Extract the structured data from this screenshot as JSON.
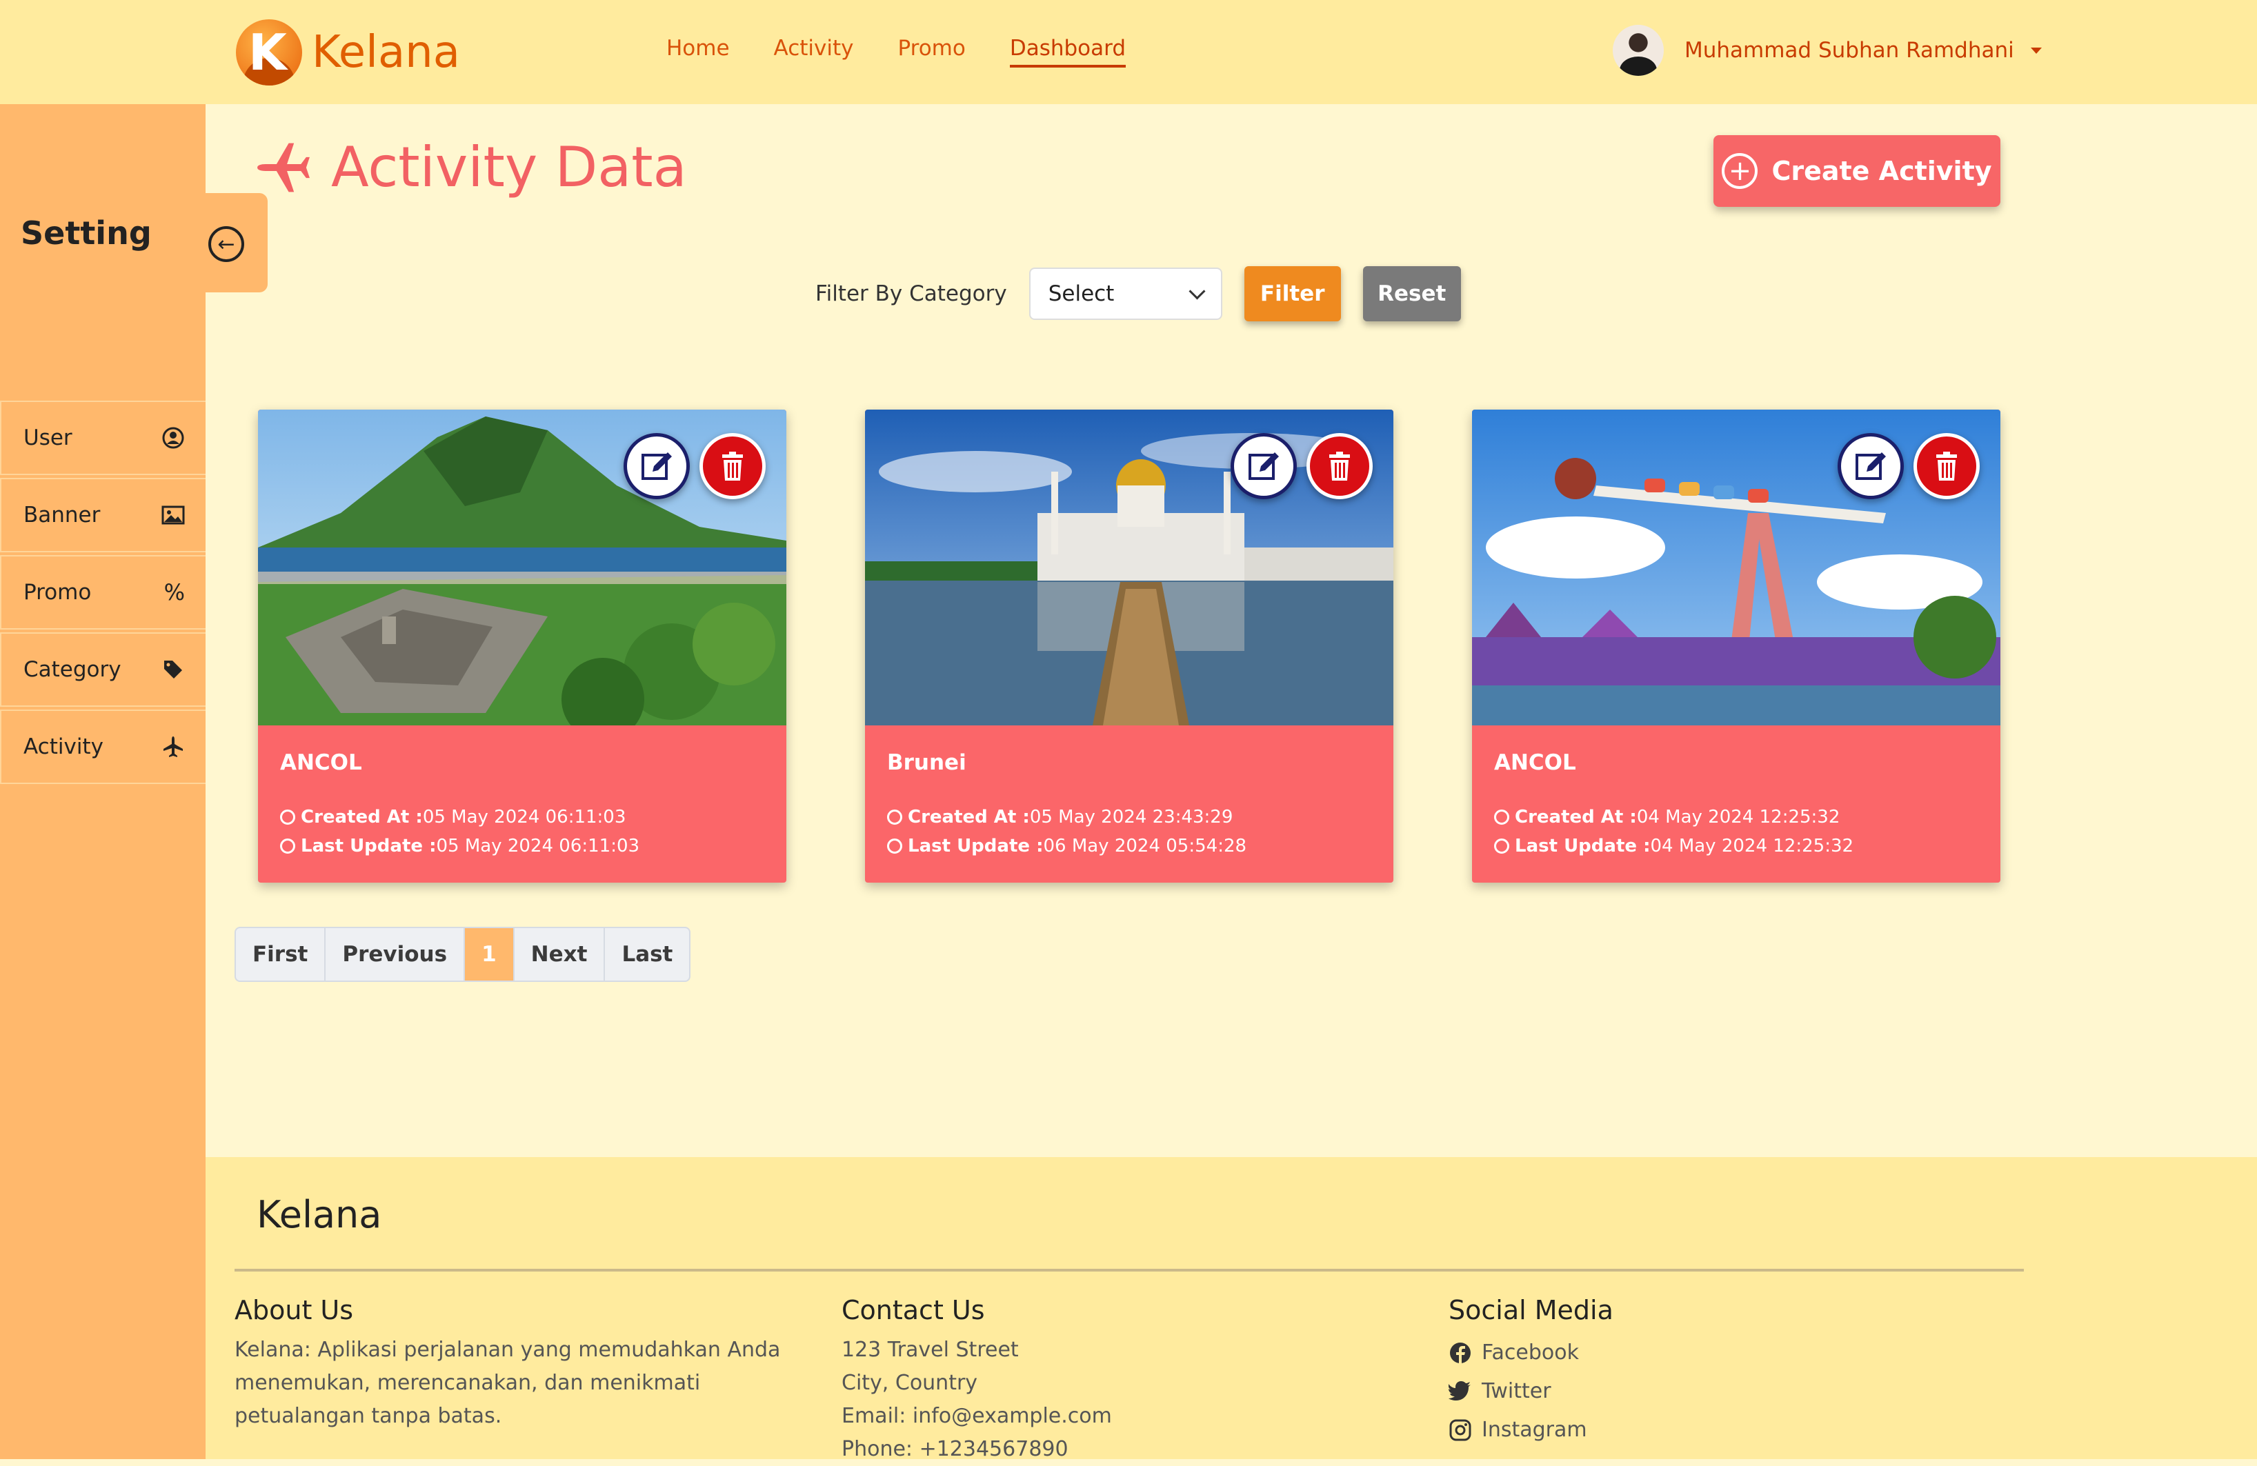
{
  "header": {
    "brand": "Kelana",
    "nav": [
      "Home",
      "Activity",
      "Promo",
      "Dashboard"
    ],
    "active_nav": "Dashboard",
    "user_name": "Muhammad Subhan Ramdhani"
  },
  "sidebar": {
    "title": "Setting",
    "items": [
      {
        "label": "User",
        "icon": "user-circle-icon"
      },
      {
        "label": "Banner",
        "icon": "image-icon"
      },
      {
        "label": "Promo",
        "icon": "percent-icon"
      },
      {
        "label": "Category",
        "icon": "tags-icon"
      },
      {
        "label": "Activity",
        "icon": "plane-icon"
      }
    ]
  },
  "main": {
    "title": "Activity Data",
    "create_label": "Create Activity",
    "filter": {
      "label": "Filter By Category",
      "select_value": "Select",
      "filter_label": "Filter",
      "reset_label": "Reset"
    },
    "cards": [
      {
        "title": "ANCOL",
        "created_label": "Created At :",
        "created": "05 May 2024 06:11:03",
        "updated_label": "Last Update :",
        "updated": "05 May 2024 06:11:03"
      },
      {
        "title": "Brunei",
        "created_label": "Created At :",
        "created": "05 May 2024 23:43:29",
        "updated_label": "Last Update :",
        "updated": "06 May 2024 05:54:28"
      },
      {
        "title": "ANCOL",
        "created_label": "Created At :",
        "created": "04 May 2024 12:25:32",
        "updated_label": "Last Update :",
        "updated": "04 May 2024 12:25:32"
      }
    ],
    "pagination": {
      "first": "First",
      "previous": "Previous",
      "current": "1",
      "next": "Next",
      "last": "Last"
    }
  },
  "footer": {
    "brand": "Kelana",
    "about": {
      "title": "About Us",
      "text": "Kelana: Aplikasi perjalanan yang memudahkan Anda menemukan, merencanakan, dan menikmati petualangan tanpa batas."
    },
    "contact": {
      "title": "Contact Us",
      "address": "123 Travel Street",
      "city": "City, Country",
      "email": "Email: info@example.com",
      "phone": "Phone: +1234567890"
    },
    "social": {
      "title": "Social Media",
      "items": [
        "Facebook",
        "Twitter",
        "Instagram"
      ]
    }
  },
  "colors": {
    "header_bg": "#ffeb9e",
    "sidebar_bg": "#ffb86c",
    "page_bg": "#fff7d0",
    "accent": "#f76667",
    "nav_text": "#d9530a"
  }
}
